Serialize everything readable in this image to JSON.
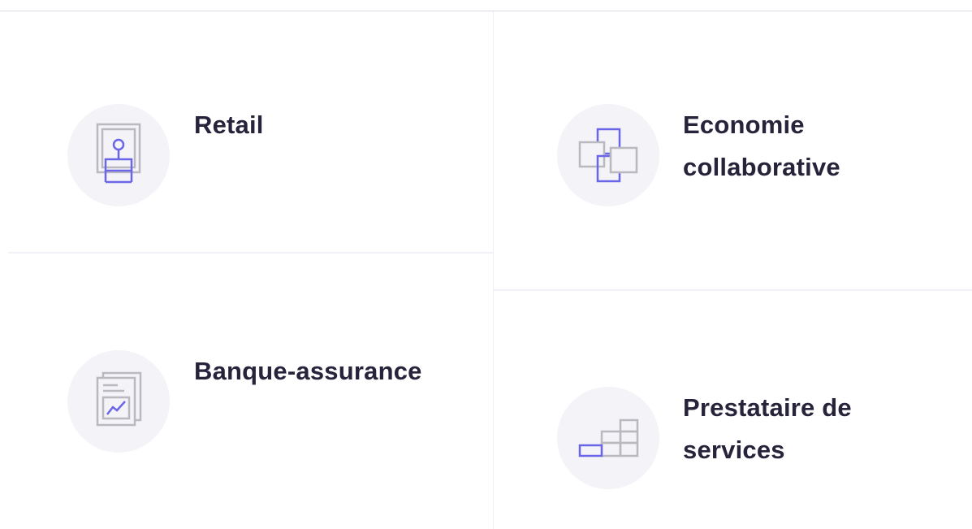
{
  "sectors": [
    {
      "title": "Retail",
      "icon": "store-display-icon"
    },
    {
      "title": "Banque-assurance",
      "icon": "financial-report-icon"
    },
    {
      "title": "Economie collaborative",
      "icon": "connected-squares-icon"
    },
    {
      "title": "Prestataire de services",
      "icon": "stacked-blocks-icon"
    }
  ],
  "colors": {
    "title_text": "#26233b",
    "icon_circle_bg": "#f3f3f8",
    "icon_gray": "#b9b9bf",
    "icon_accent": "#6b66e8",
    "divider": "#eeeef6"
  }
}
